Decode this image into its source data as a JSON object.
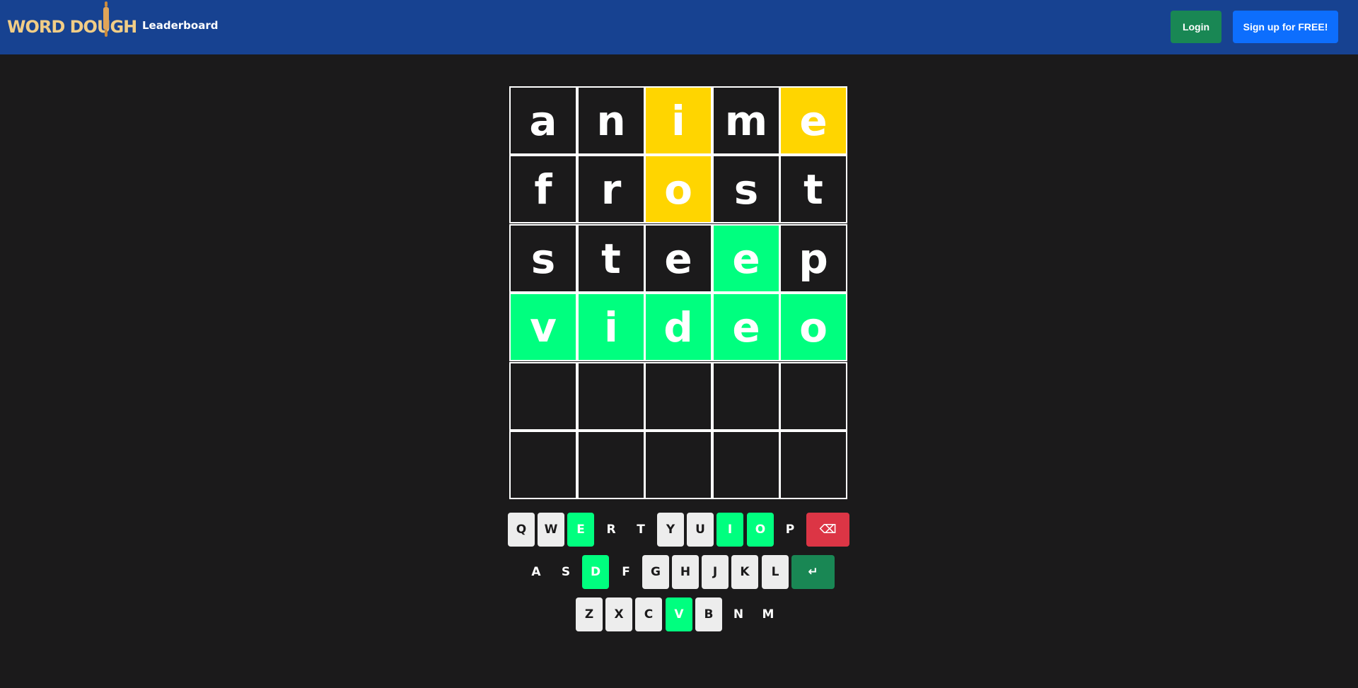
{
  "navbar": {
    "logo_text": "WORD DOUGH",
    "leaderboard_label": "Leaderboard",
    "login_label": "Login",
    "signup_label": "Sign up for FREE!"
  },
  "board": {
    "rows": [
      [
        {
          "letter": "a",
          "state": "absent"
        },
        {
          "letter": "n",
          "state": "absent"
        },
        {
          "letter": "i",
          "state": "present"
        },
        {
          "letter": "m",
          "state": "absent"
        },
        {
          "letter": "e",
          "state": "present"
        }
      ],
      [
        {
          "letter": "f",
          "state": "absent"
        },
        {
          "letter": "r",
          "state": "absent"
        },
        {
          "letter": "o",
          "state": "present"
        },
        {
          "letter": "s",
          "state": "absent"
        },
        {
          "letter": "t",
          "state": "absent"
        }
      ],
      [
        {
          "letter": "s",
          "state": "absent"
        },
        {
          "letter": "t",
          "state": "absent"
        },
        {
          "letter": "e",
          "state": "absent"
        },
        {
          "letter": "e",
          "state": "correct"
        },
        {
          "letter": "p",
          "state": "absent"
        }
      ],
      [
        {
          "letter": "v",
          "state": "correct"
        },
        {
          "letter": "i",
          "state": "correct"
        },
        {
          "letter": "d",
          "state": "correct"
        },
        {
          "letter": "e",
          "state": "correct"
        },
        {
          "letter": "o",
          "state": "correct"
        }
      ],
      [
        {
          "letter": "",
          "state": "empty"
        },
        {
          "letter": "",
          "state": "empty"
        },
        {
          "letter": "",
          "state": "empty"
        },
        {
          "letter": "",
          "state": "empty"
        },
        {
          "letter": "",
          "state": "empty"
        }
      ],
      [
        {
          "letter": "",
          "state": "empty"
        },
        {
          "letter": "",
          "state": "empty"
        },
        {
          "letter": "",
          "state": "empty"
        },
        {
          "letter": "",
          "state": "empty"
        },
        {
          "letter": "",
          "state": "empty"
        }
      ]
    ]
  },
  "keyboard": {
    "rows": [
      [
        {
          "label": "Q",
          "state": "unused"
        },
        {
          "label": "W",
          "state": "unused"
        },
        {
          "label": "E",
          "state": "correct"
        },
        {
          "label": "R",
          "state": "absent"
        },
        {
          "label": "T",
          "state": "absent"
        },
        {
          "label": "Y",
          "state": "unused"
        },
        {
          "label": "U",
          "state": "unused"
        },
        {
          "label": "I",
          "state": "correct"
        },
        {
          "label": "O",
          "state": "correct"
        },
        {
          "label": "P",
          "state": "absent"
        },
        {
          "label": "⌫",
          "state": "backspace"
        }
      ],
      [
        {
          "label": "A",
          "state": "absent"
        },
        {
          "label": "S",
          "state": "absent"
        },
        {
          "label": "D",
          "state": "correct"
        },
        {
          "label": "F",
          "state": "absent"
        },
        {
          "label": "G",
          "state": "unused"
        },
        {
          "label": "H",
          "state": "unused"
        },
        {
          "label": "J",
          "state": "unused"
        },
        {
          "label": "K",
          "state": "unused"
        },
        {
          "label": "L",
          "state": "unused"
        },
        {
          "label": "↵",
          "state": "enter"
        }
      ],
      [
        {
          "label": "Z",
          "state": "unused"
        },
        {
          "label": "X",
          "state": "unused"
        },
        {
          "label": "C",
          "state": "unused"
        },
        {
          "label": "V",
          "state": "correct"
        },
        {
          "label": "B",
          "state": "unused"
        },
        {
          "label": "N",
          "state": "absent"
        },
        {
          "label": "M",
          "state": "absent"
        }
      ]
    ]
  },
  "colors": {
    "navbar": "#174291",
    "background": "#1b1a1b",
    "present": "#ffd500",
    "correct": "#00ff7f",
    "login": "#198754",
    "signup": "#0d6efd",
    "backspace": "#dc3545",
    "logo": "#f1cd86"
  }
}
